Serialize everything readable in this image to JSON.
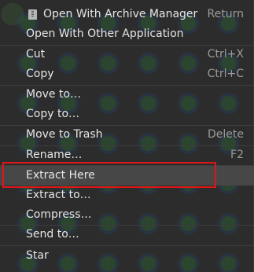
{
  "menu": {
    "items": [
      {
        "label": "Open With Archive Manager",
        "accel": "Return",
        "icon": "archive-manager-icon"
      },
      {
        "label": "Open With Other Application",
        "accel": ""
      },
      {
        "label": "Cut",
        "accel": "Ctrl+X"
      },
      {
        "label": "Copy",
        "accel": "Ctrl+C"
      },
      {
        "label": "Move to…",
        "accel": ""
      },
      {
        "label": "Copy to…",
        "accel": ""
      },
      {
        "label": "Move to Trash",
        "accel": "Delete"
      },
      {
        "label": "Rename…",
        "accel": "F2"
      },
      {
        "label": "Extract Here",
        "accel": ""
      },
      {
        "label": "Extract to…",
        "accel": ""
      },
      {
        "label": "Compress…",
        "accel": ""
      },
      {
        "label": "Send to…",
        "accel": ""
      },
      {
        "label": "Star",
        "accel": ""
      }
    ],
    "highlighted_item": "Extract Here",
    "highlight_color": "#e01616",
    "hover_bg": "#474747",
    "menu_bg": "#2c2c2c"
  }
}
